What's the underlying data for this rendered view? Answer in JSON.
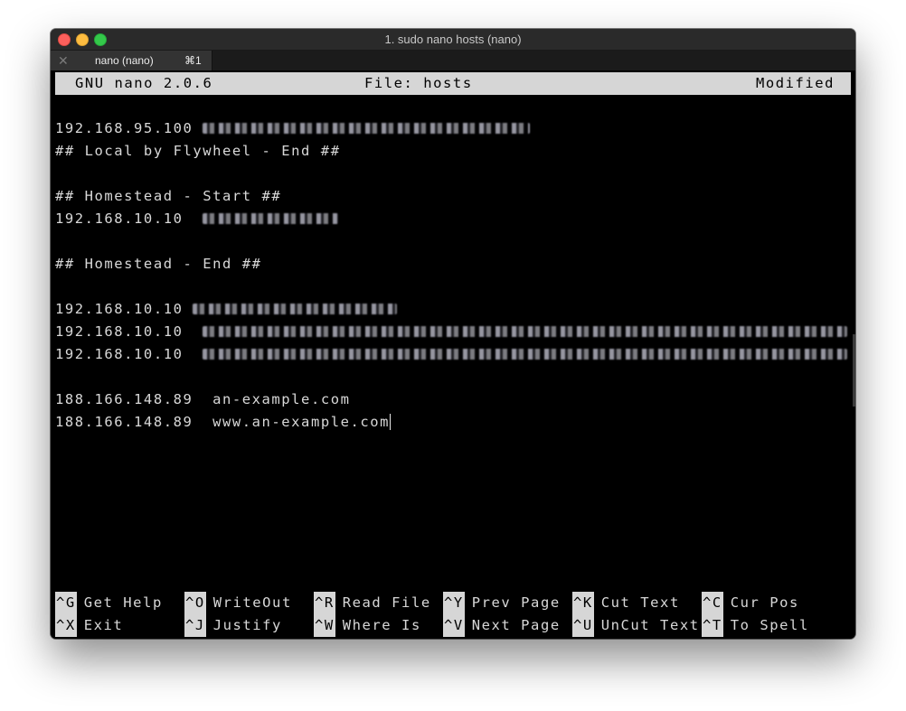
{
  "window": {
    "title": "1. sudo nano hosts (nano)"
  },
  "tab": {
    "title": "nano (nano)",
    "shortcut": "⌘1"
  },
  "header": {
    "app": "GNU nano 2.0.6",
    "file": "File: hosts",
    "status": "Modified"
  },
  "lines": [
    {
      "ip": "192.168.95.100"
    },
    {
      "text": "## Local by Flywheel - End ##"
    },
    {
      "text": "## Homestead - Start ##"
    },
    {
      "ip": "192.168.10.10"
    },
    {
      "text": "## Homestead - End ##"
    },
    {
      "ip": "192.168.10.10"
    },
    {
      "ip": "192.168.10.10"
    },
    {
      "ip": "192.168.10.10"
    },
    {
      "ip": "188.166.148.89",
      "host": "an-example.com"
    },
    {
      "ip": "188.166.148.89",
      "host": "www.an-example.com"
    }
  ],
  "shortcuts": [
    [
      {
        "key": "^G",
        "label": "Get Help"
      },
      {
        "key": "^O",
        "label": "WriteOut"
      },
      {
        "key": "^R",
        "label": "Read File"
      },
      {
        "key": "^Y",
        "label": "Prev Page"
      },
      {
        "key": "^K",
        "label": "Cut Text"
      },
      {
        "key": "^C",
        "label": "Cur Pos"
      }
    ],
    [
      {
        "key": "^X",
        "label": "Exit"
      },
      {
        "key": "^J",
        "label": "Justify"
      },
      {
        "key": "^W",
        "label": "Where Is"
      },
      {
        "key": "^V",
        "label": "Next Page"
      },
      {
        "key": "^U",
        "label": "UnCut Text"
      },
      {
        "key": "^T",
        "label": "To Spell"
      }
    ]
  ]
}
